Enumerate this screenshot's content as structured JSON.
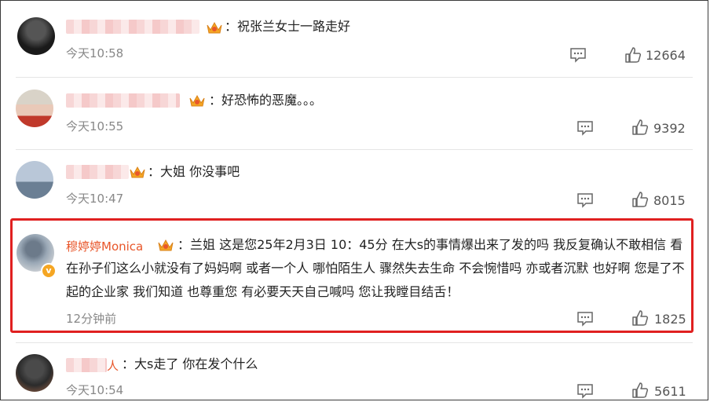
{
  "comments": [
    {
      "text": "：祝张兰女士一路走好",
      "time": "今天10:58",
      "likes": "12664",
      "reply_icon": "comment-icon",
      "like_icon": "thumbs-up-icon"
    },
    {
      "text": "：好恐怖的恶魔。。。",
      "time": "今天10:55",
      "likes": "9392",
      "reply_icon": "comment-icon",
      "like_icon": "thumbs-up-icon"
    },
    {
      "text": "：大姐 你没事吧",
      "time": "今天10:47",
      "likes": "8015",
      "reply_icon": "comment-icon",
      "like_icon": "thumbs-up-icon"
    },
    {
      "username": "穆婷婷Monica",
      "text": "：兰姐 这是您25年2月3日 10：45分 在大s的事情爆出来了发的吗 我反复确认不敢相信 看在孙子们这么小就没有了妈妈啊 或者一个人 哪怕陌生人 骤然失去生命 不会惋惜吗 亦或者沉默 也好啊 您是了不起的企业家 我们知道 也尊重您 有必要天天自己喊吗 您让我瞠目结舌！",
      "time": "12分钟前",
      "likes": "1825",
      "verified_badge": "v",
      "highlight_color": "#e02020",
      "username_color": "#e8562a"
    },
    {
      "name_suffix": "人",
      "text": "：大s走了 你在发个什么",
      "time": "今天10:54",
      "likes": "5611"
    }
  ]
}
